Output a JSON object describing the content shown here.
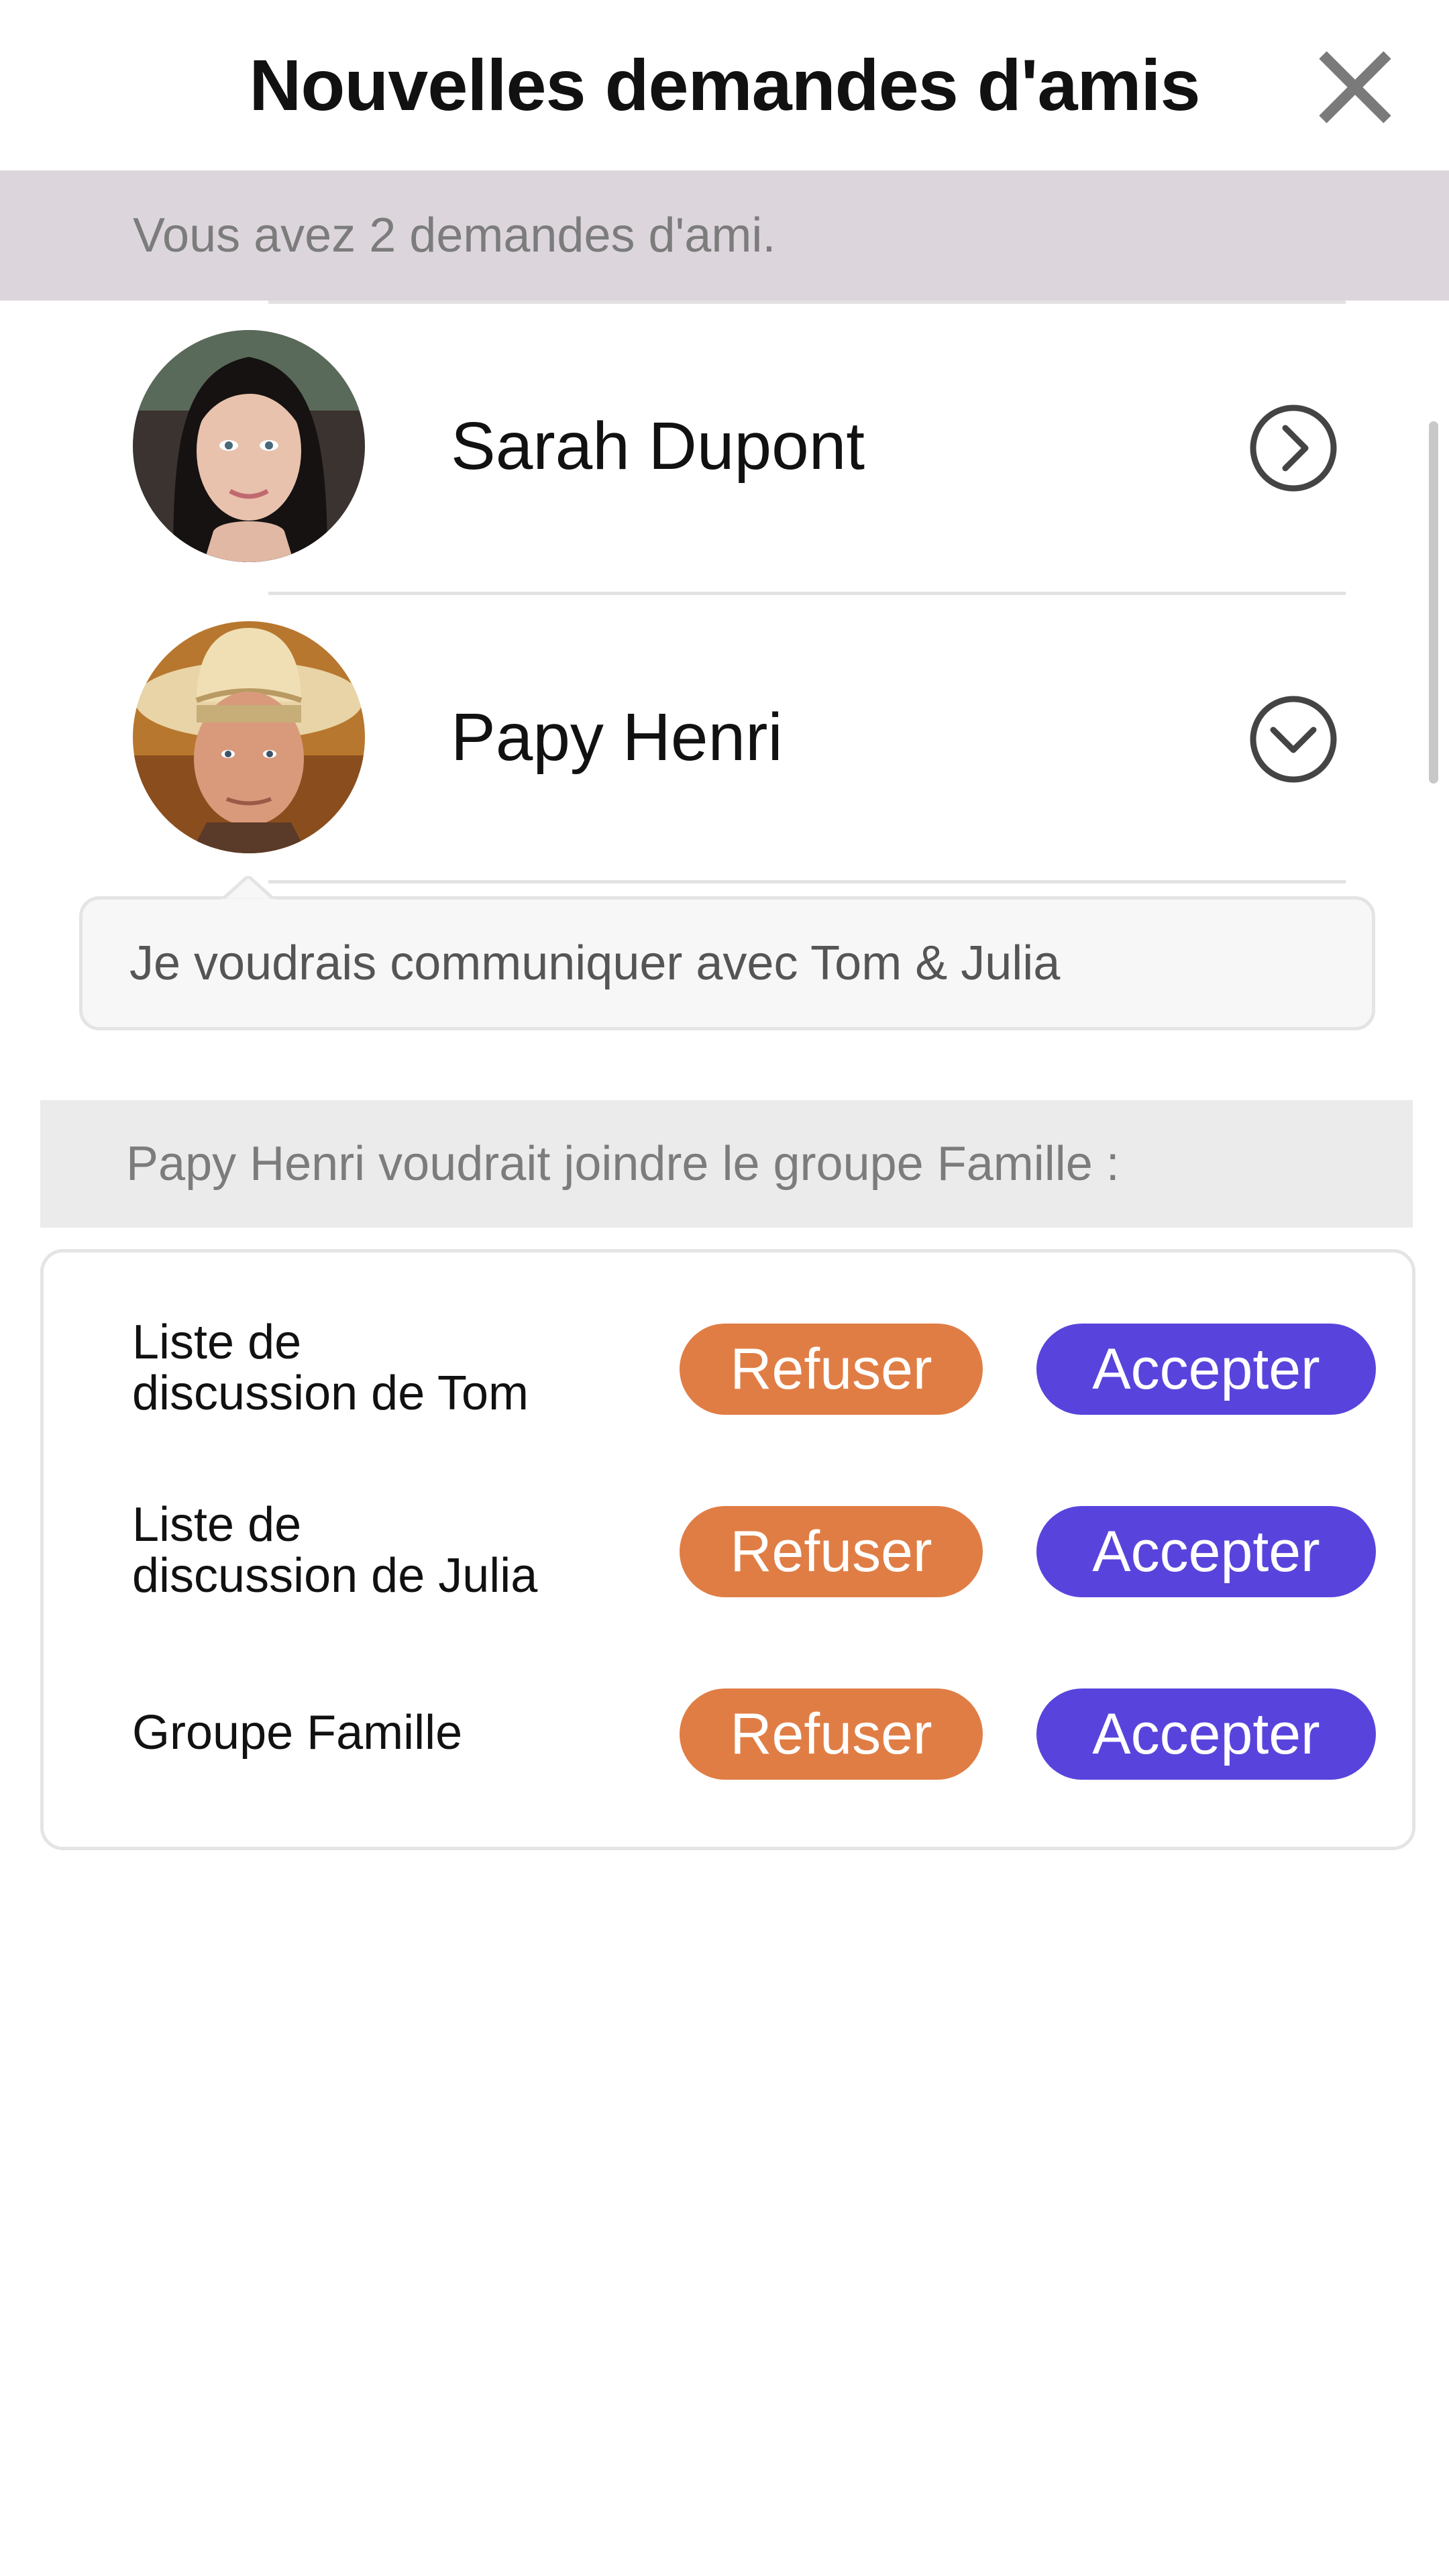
{
  "header": {
    "title": "Nouvelles demandes d'amis",
    "close_icon": "close-icon"
  },
  "summary": {
    "text": "Vous avez 2 demandes d'ami."
  },
  "requests": [
    {
      "name": "Sarah Dupont",
      "avatar": "woman-portrait-avatar",
      "chevron_icon": "chevron-right-circle-icon",
      "expanded": false
    },
    {
      "name": "Papy Henri",
      "avatar": "man-cowboy-hat-avatar",
      "chevron_icon": "chevron-down-circle-icon",
      "expanded": true
    }
  ],
  "message": {
    "text": "Je voudrais communiquer avec Tom & Julia"
  },
  "group_banner": {
    "text": "Papy Henri voudrait joindre le groupe Famille :"
  },
  "group_requests": [
    {
      "label_line1": "Liste de",
      "label_line2": "discussion de Tom",
      "refuse_label": "Refuser",
      "accept_label": "Accepter"
    },
    {
      "label_line1": "Liste de",
      "label_line2": "discussion de Julia",
      "refuse_label": "Refuser",
      "accept_label": "Accepter"
    },
    {
      "label_line1": "Groupe Famille",
      "label_line2": "",
      "refuse_label": "Refuser",
      "accept_label": "Accepter"
    }
  ],
  "colors": {
    "refuse": "#e07d45",
    "accept": "#5844dc",
    "summary_bg": "#dcd6dc",
    "banner_bg": "#ebebeb"
  }
}
